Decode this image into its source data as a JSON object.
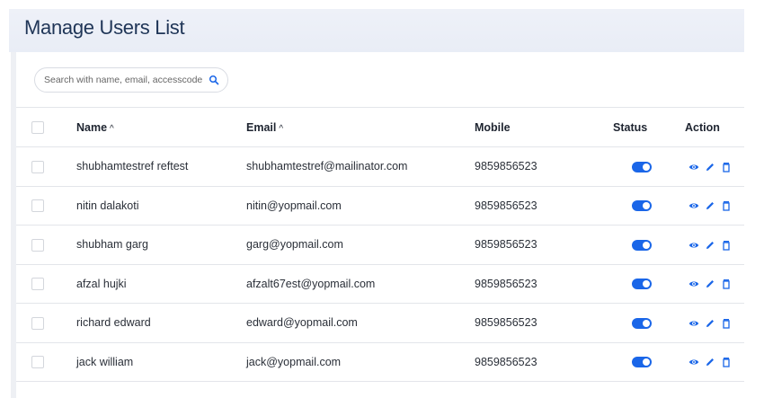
{
  "page": {
    "title": "Manage Users List"
  },
  "search": {
    "placeholder": "Search with name, email, accesscode",
    "value": "",
    "icon": "search-icon"
  },
  "table": {
    "headers": {
      "name": "Name",
      "email": "Email",
      "mobile": "Mobile",
      "status": "Status",
      "action": "Action",
      "sort_indicator": "^"
    },
    "rows": [
      {
        "name": "shubhamtestref reftest",
        "email": "shubhamtestref@mailinator.com",
        "mobile": "9859856523",
        "status": "active"
      },
      {
        "name": "nitin dalakoti",
        "email": "nitin@yopmail.com",
        "mobile": "9859856523",
        "status": "active"
      },
      {
        "name": "shubham garg",
        "email": "garg@yopmail.com",
        "mobile": "9859856523",
        "status": "active"
      },
      {
        "name": "afzal hujki",
        "email": "afzalt67est@yopmail.com",
        "mobile": "9859856523",
        "status": "active"
      },
      {
        "name": "richard edward",
        "email": "edward@yopmail.com",
        "mobile": "9859856523",
        "status": "active"
      },
      {
        "name": "jack william",
        "email": "jack@yopmail.com",
        "mobile": "9859856523",
        "status": "active"
      }
    ],
    "action_icons": [
      "eye-icon",
      "pencil-icon",
      "trash-icon"
    ]
  },
  "colors": {
    "accent": "#1a66e8",
    "title": "#1f3557",
    "header_bg": "#eef1f8"
  }
}
